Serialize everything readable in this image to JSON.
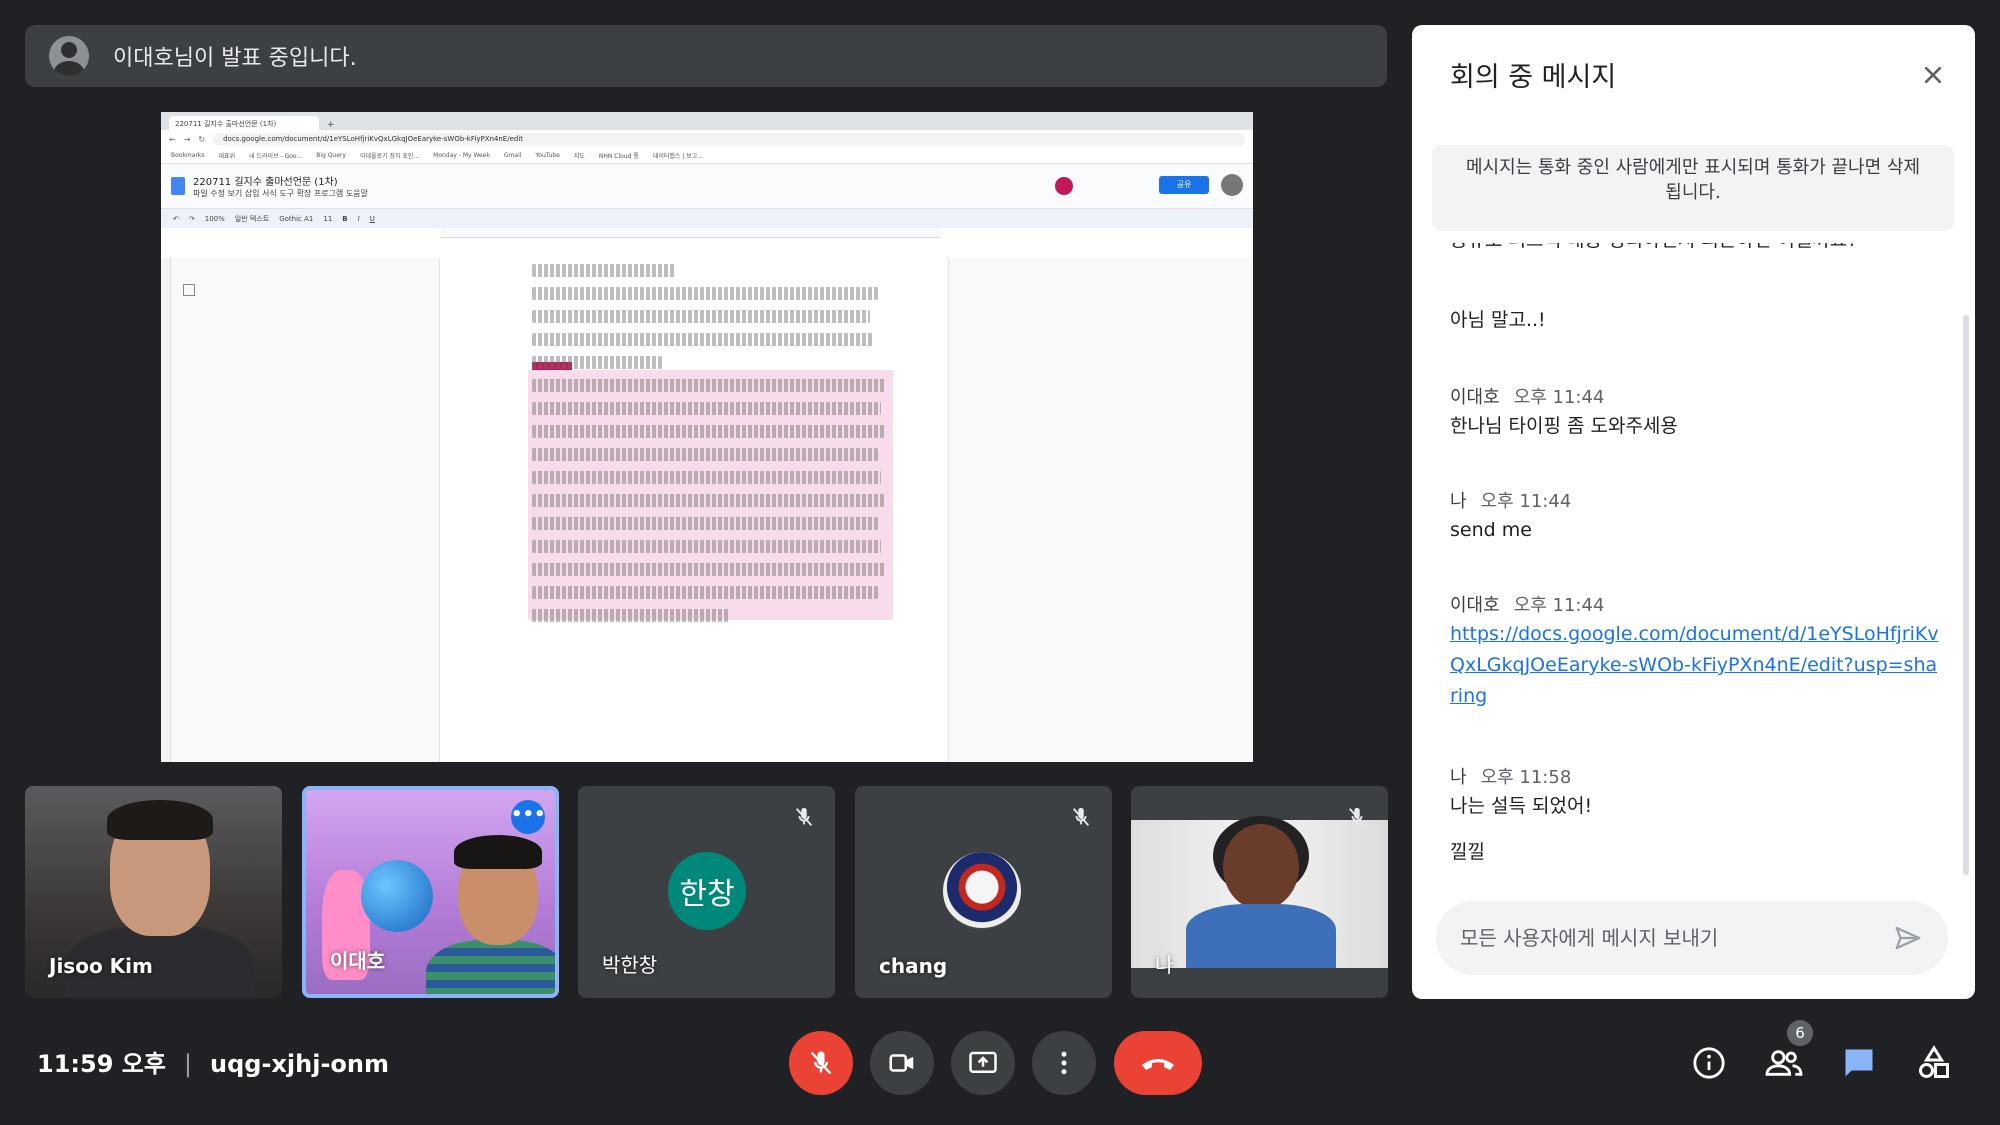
{
  "banner": {
    "text": "이대호님이 발표 중입니다."
  },
  "shared_screen": {
    "browser_tab": "220711 길지수 출마선언문 (1차)",
    "url": "docs.google.com/document/d/1eYSLoHfjriKvQxLGkqJOeEaryke-sWOb-kFiyPXn4nE/edit",
    "bookmarks": [
      "Bookmarks",
      "대표위",
      "내 드라이브 - Goo...",
      "Big Query",
      "이데올로기 정치 포인...",
      "Monday - My Week",
      "Gmail",
      "YouTube",
      "지도",
      "NHN Cloud 통",
      "데이터랩스 | 보고..."
    ],
    "doc_title": "220711 길지수 출마선언문 (1차)",
    "doc_menu": "파일  수정  보기  삽입  서식  도구  확장 프로그램  도움말",
    "share_label": "공유",
    "zoom": "100%",
    "style_label": "일반 텍스트",
    "font_label": "Gothic A1",
    "font_size": "11"
  },
  "participants": [
    {
      "name": "Jisoo Kim",
      "muted": false
    },
    {
      "name": "이대호",
      "muted": false,
      "speaking": true
    },
    {
      "name": "박한창",
      "avatar_text": "한창",
      "avatar_color": "#00897b",
      "muted": true
    },
    {
      "name": "chang",
      "muted": true
    },
    {
      "name": "나",
      "muted": true
    }
  ],
  "chat": {
    "title": "회의 중 메시지",
    "notice": "메시지는 통화 중인 사람에게만 표시되며 통화가 끝나면 삭제됩니다.",
    "partial_top": "공유도 퍼드백 내용 정리하던지 의논하던 어떨까요?",
    "messages": [
      {
        "sender": "",
        "time": "",
        "text": "아님 말고..!"
      },
      {
        "sender": "이대호",
        "time": "오후 11:44",
        "text": "한나님 타이핑 좀 도와주세용"
      },
      {
        "sender": "나",
        "time": "오후 11:44",
        "text": "send me"
      },
      {
        "sender": "이대호",
        "time": "오후 11:44",
        "text": "https://docs.google.com/document/d/1eYSLoHfjriKvQxLGkqJOeEaryke-sWOb-kFiyPXn4nE/edit?usp=sharing",
        "is_link": true
      },
      {
        "sender": "나",
        "time": "오후 11:58",
        "text": "나는 설득 되었어!"
      },
      {
        "sender": "",
        "time": "",
        "text": "낄낄"
      }
    ],
    "input_placeholder": "모든 사용자에게 메시지 보내기"
  },
  "bottom": {
    "time": "11:59 오후",
    "meeting_code": "uqg-xjhj-onm",
    "participants_count": "6"
  },
  "colors": {
    "accent": "#8ab4f8",
    "danger": "#ea4335",
    "chat_active": "#8ab4f8"
  }
}
